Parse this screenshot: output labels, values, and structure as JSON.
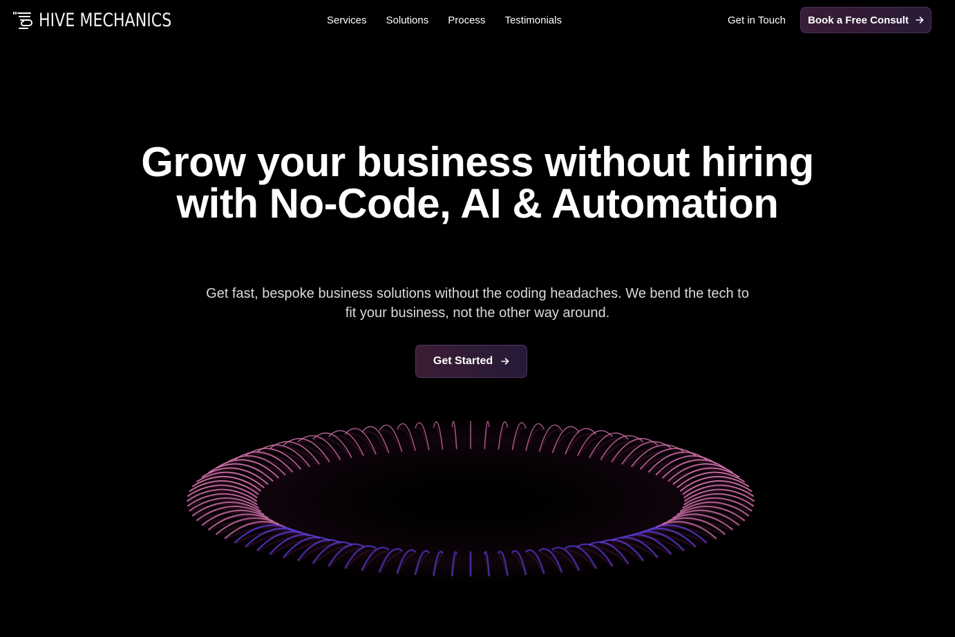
{
  "brand": {
    "name": "HIVE MECHANICS",
    "logo_icon": "hive-wire-icon"
  },
  "nav": {
    "links": [
      {
        "label": "Services"
      },
      {
        "label": "Solutions"
      },
      {
        "label": "Process"
      },
      {
        "label": "Testimonials"
      }
    ],
    "contact_label": "Get in Touch",
    "cta_label": "Book a Free Consult",
    "cta_icon": "arrow-right-icon"
  },
  "hero": {
    "title": "Grow your business without hiring with No-Code, AI & Automation",
    "subtitle": "Get fast, bespoke business solutions without the coding headaches. We bend the tech to fit your business, not the other way around.",
    "cta_label": "Get Started",
    "cta_icon": "arrow-right-icon"
  },
  "colors": {
    "background": "#000000",
    "text": "#ffffff",
    "subtext": "#dadada",
    "button_gradient_start": "#3b1d34",
    "button_gradient_end": "#261a38",
    "ring_pink": "#e07ab8",
    "ring_violet": "#6a46ff"
  }
}
